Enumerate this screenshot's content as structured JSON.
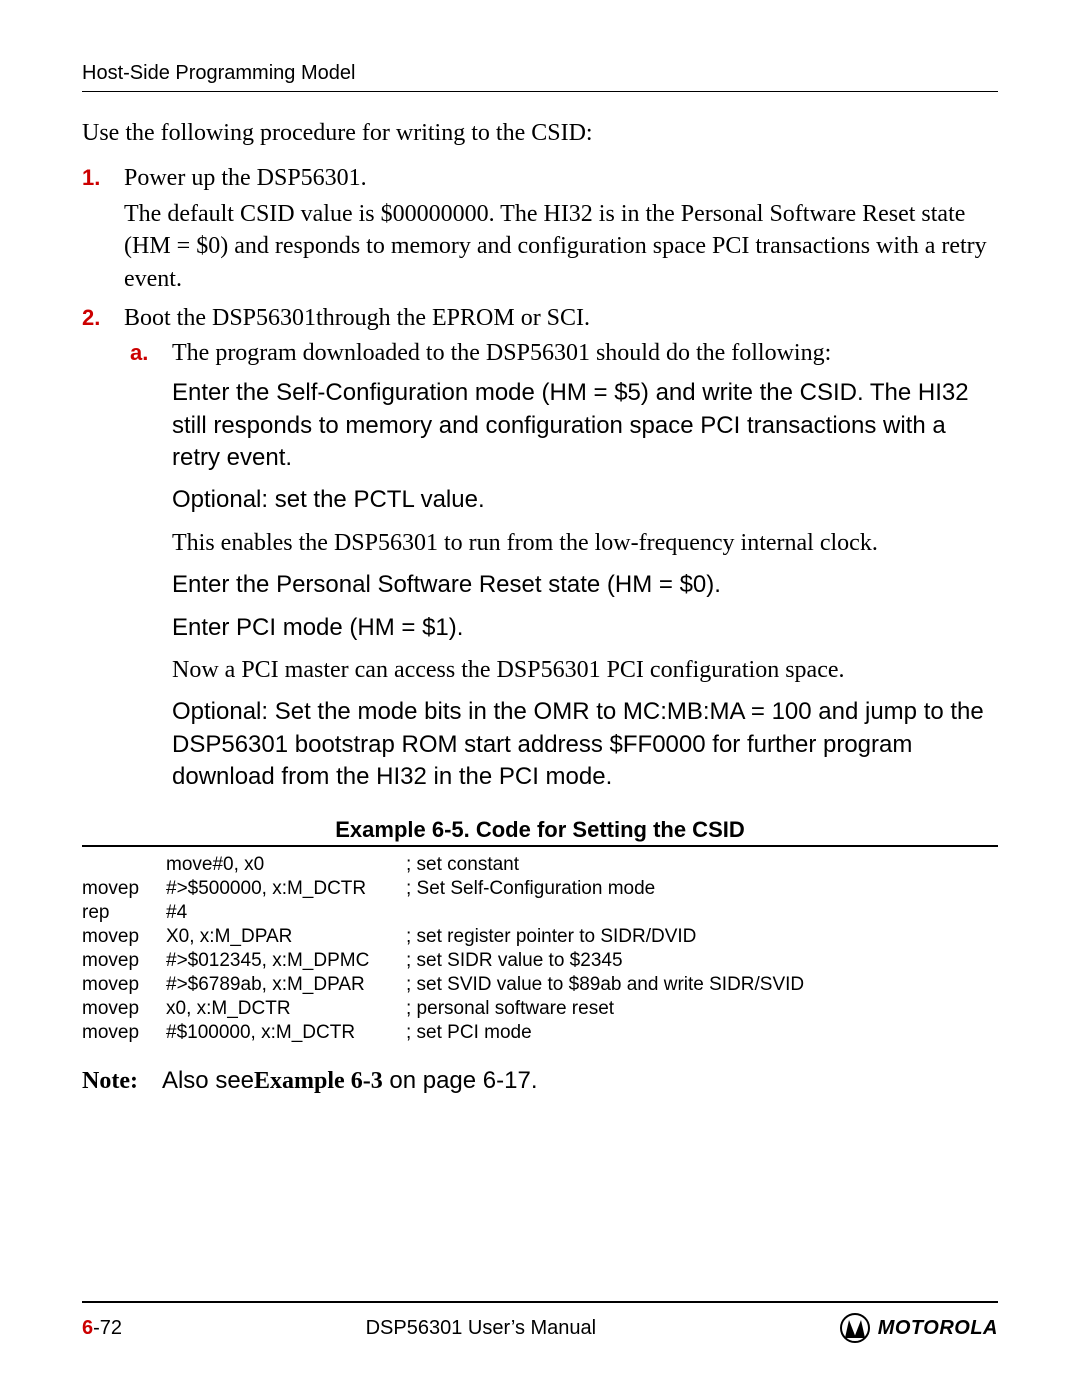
{
  "header": {
    "section": "Host-Side Programming Model"
  },
  "intro": "Use the following procedure for writing to the CSID:",
  "items": {
    "i1": {
      "num": "1.",
      "lead": "Power up the DSP56301.",
      "body": "The default CSID value is $00000000. The HI32 is in the Personal Software Reset state (HM = $0) and responds to memory and configuration space PCI transactions with a retry event."
    },
    "i2": {
      "num": "2.",
      "lead": "Boot the DSP56301through the EPROM or SCI.",
      "a": {
        "num": "a.",
        "lead": "The program downloaded to the DSP56301 should do the following:",
        "b1": "Enter the Self-Configuration mode (HM = $5) and write the CSID. The HI32 still responds to memory and configuration space PCI transactions with a retry event.",
        "b2": "Optional: set the PCTL value.",
        "b3": "This enables the DSP56301 to run from the low-frequency internal clock.",
        "b4": "Enter the Personal Software Reset state (HM = $0).",
        "b5": "Enter PCI mode (HM = $1).",
        "b6": "Now a PCI master can access the DSP56301 PCI configuration space.",
        "b7": "Optional: Set the mode bits in the OMR to MC:MB:MA = 100 and jump to the DSP56301 bootstrap ROM start address $FF0000 for further program download from the HI32 in the PCI mode."
      }
    }
  },
  "example": {
    "title": "Example 6-5.  Code for Setting the CSID",
    "rows": [
      {
        "c1": "",
        "c2": "move#0, x0",
        "c3": "; set constant"
      },
      {
        "c1": "movep",
        "c2": "#>$500000, x:M_DCTR",
        "c3": "; Set Self-Configuration mode"
      },
      {
        "c1": "rep",
        "c2": "#4",
        "c3": ""
      },
      {
        "c1": "movep",
        "c2": "X0, x:M_DPAR",
        "c3": "; set register pointer to SIDR/DVID"
      },
      {
        "c1": "movep",
        "c2": "#>$012345, x:M_DPMC",
        "c3": "; set SIDR value to $2345"
      },
      {
        "c1": "movep",
        "c2": "#>$6789ab, x:M_DPAR",
        "c3": "; set SVID value to $89ab and write SIDR/SVID"
      },
      {
        "c1": "movep",
        "c2": "x0, x:M_DCTR",
        "c3": "; personal software reset"
      },
      {
        "c1": "movep",
        "c2": "#$100000, x:M_DCTR",
        "c3": "; set PCI mode"
      }
    ]
  },
  "note": {
    "label": "Note:",
    "pre": "Also see",
    "xref": "Example 6-3",
    "post": " on page 6-17."
  },
  "footer": {
    "chapter": "6",
    "page": "-72",
    "center": "DSP56301 User’s Manual",
    "brand": "MOTOROLA"
  }
}
